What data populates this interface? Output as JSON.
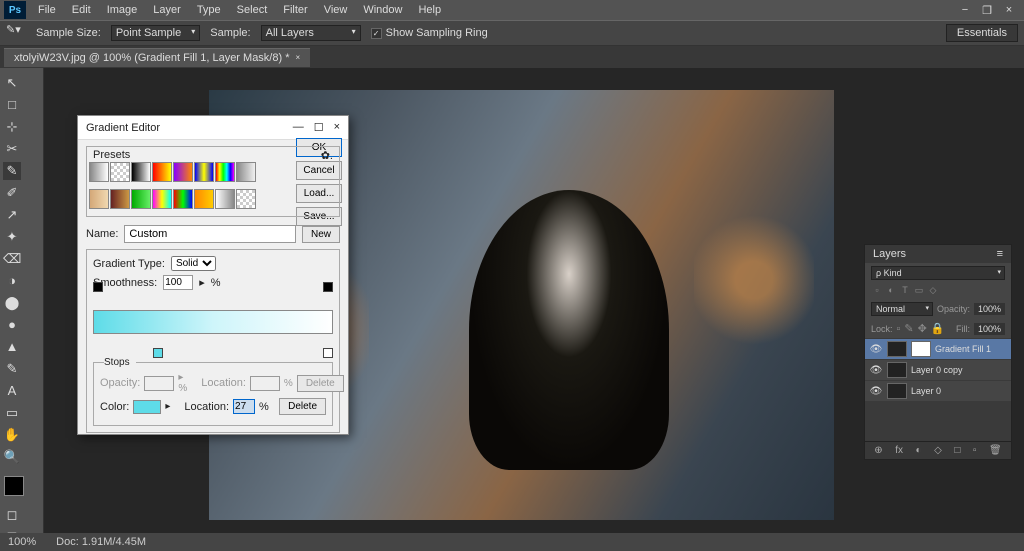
{
  "menubar": {
    "items": [
      "File",
      "Edit",
      "Image",
      "Layer",
      "Type",
      "Select",
      "Filter",
      "View",
      "Window",
      "Help"
    ],
    "logo": "Ps"
  },
  "winctl": {
    "min": "−",
    "max": "❐",
    "close": "×"
  },
  "optbar": {
    "sample_size_lbl": "Sample Size:",
    "sample_size_val": "Point Sample",
    "sample_lbl": "Sample:",
    "sample_val": "All Layers",
    "checkbox_lbl": "Show Sampling Ring",
    "right": "Essentials"
  },
  "doctab": {
    "title": "xtolyiW23V.jpg @ 100% (Gradient Fill 1, Layer Mask/8) *",
    "close": "×"
  },
  "toolbar": {
    "tools": [
      "↖",
      "□",
      "⊹",
      "✂",
      "✎",
      "✐",
      "↗",
      "✦",
      "⌫",
      "◑",
      "⬤",
      "●",
      "▲",
      "✎",
      "A",
      "▭",
      "✋",
      "🔍"
    ]
  },
  "statusbar": {
    "zoom": "100%",
    "doc": "Doc: 1.91M/4.45M"
  },
  "layers": {
    "title": "Layers",
    "kind_lbl": "ρ Kind",
    "blend": "Normal",
    "opacity_lbl": "Opacity:",
    "opacity_val": "100%",
    "lock_lbl": "Lock:",
    "fill_lbl": "Fill:",
    "fill_val": "100%",
    "items": [
      {
        "name": "Gradient Fill 1",
        "selected": true,
        "hasMask": true
      },
      {
        "name": "Layer 0 copy",
        "selected": false,
        "hasMask": false
      },
      {
        "name": "Layer 0",
        "selected": false,
        "hasMask": false
      }
    ],
    "ftr": [
      "⊕",
      "fx",
      "◐",
      "◇",
      "□",
      "🗑"
    ]
  },
  "ged": {
    "title": "Gradient Editor",
    "ok": "OK",
    "cancel": "Cancel",
    "load": "Load...",
    "save": "Save...",
    "presets_lbl": "Presets",
    "gear": "✿.",
    "name_lbl": "Name:",
    "name_val": "Custom",
    "new_btn": "New",
    "type_lbl": "Gradient Type:",
    "type_val": "Solid",
    "smooth_lbl": "Smoothness:",
    "smooth_val": "100",
    "pct": "%",
    "stops_lbl": "Stops",
    "opacity_lbl": "Opacity:",
    "location_lbl": "Location:",
    "color_lbl": "Color:",
    "loc_val": "27",
    "delete": "Delete",
    "minimize": "—",
    "maxbox": "☐",
    "close": "×"
  },
  "presets_bg": [
    "linear-gradient(90deg,#888,#fff)",
    "repeating-conic-gradient(#ccc 0 25%,#fff 0 50%) 0/6px 6px",
    "linear-gradient(90deg,#000,#fff)",
    "linear-gradient(90deg,#f00,#ff0)",
    "linear-gradient(90deg,#80f,#f80)",
    "linear-gradient(90deg,#00f,#ff0,#00f)",
    "linear-gradient(90deg,#f00,#ff0,#0f0,#0ff,#00f,#f0f)",
    "linear-gradient(90deg,#888,transparent)",
    "linear-gradient(90deg,#d4a878,#f0d8b0)",
    "linear-gradient(90deg,#622,#c94)",
    "linear-gradient(90deg,#0a0,#6e6)",
    "linear-gradient(90deg,#f0f,#ff0,#0ff)",
    "linear-gradient(90deg,#f00,#0f0,#00f)",
    "linear-gradient(90deg,#f80,#fc0)",
    "linear-gradient(90deg,#fff,#888)",
    "repeating-conic-gradient(#ccc 0 25%,#fff 0 50%) 0/6px 6px"
  ]
}
